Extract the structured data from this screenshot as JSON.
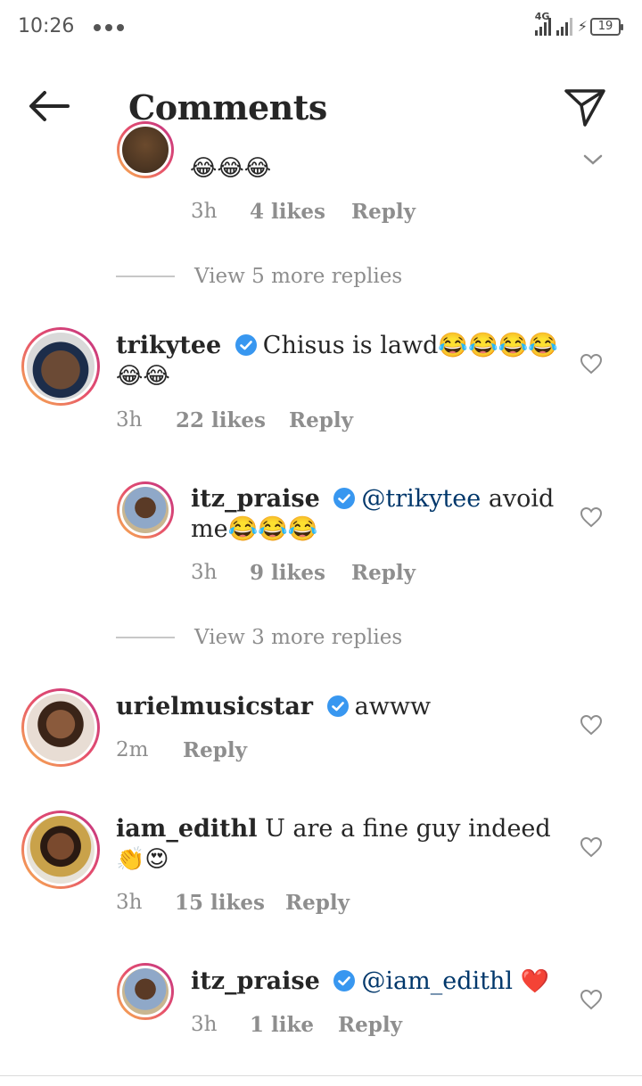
{
  "status_bar": {
    "time": "10:26",
    "network": "4G",
    "battery": "19"
  },
  "header": {
    "title": "Comments"
  },
  "top_partial": {
    "emojis": "😂😂😂",
    "time": "3h",
    "likes": "4 likes",
    "reply": "Reply"
  },
  "view_more_1": {
    "label": "View 5 more replies"
  },
  "comments": [
    {
      "username": "trikytee",
      "text": "Chisus is lawd😂😂😂😂",
      "text2": "😂😂",
      "time": "3h",
      "likes": "22 likes",
      "reply": "Reply"
    },
    {
      "username": "itz_praise",
      "mention": "@trikytee",
      "text": "avoid",
      "text2": "me😂😂😂",
      "time": "3h",
      "likes": "9 likes",
      "reply": "Reply"
    },
    {
      "username": "urielmusicstar",
      "text": "awww",
      "time": "2m",
      "reply": "Reply"
    },
    {
      "username": "iam_edithl",
      "text": "U are a fine guy indeed",
      "text2": "👏😍",
      "time": "3h",
      "likes": "15 likes",
      "reply": "Reply"
    },
    {
      "username": "itz_praise",
      "mention": "@iam_edithl",
      "text": "❤️",
      "time": "3h",
      "likes": "1 like",
      "reply": "Reply"
    }
  ],
  "view_more_2": {
    "label": "View 3 more replies"
  },
  "colors": {
    "mention": "#00376b",
    "verified": "#3897f0",
    "meta": "#8e8e8e",
    "heart_red": "#e0245e"
  },
  "icons": {
    "back": "arrow-left-icon",
    "send": "paper-plane-icon",
    "heart": "heart-outline-icon",
    "verified": "verified-badge-icon",
    "chevron": "chevron-down-icon"
  }
}
